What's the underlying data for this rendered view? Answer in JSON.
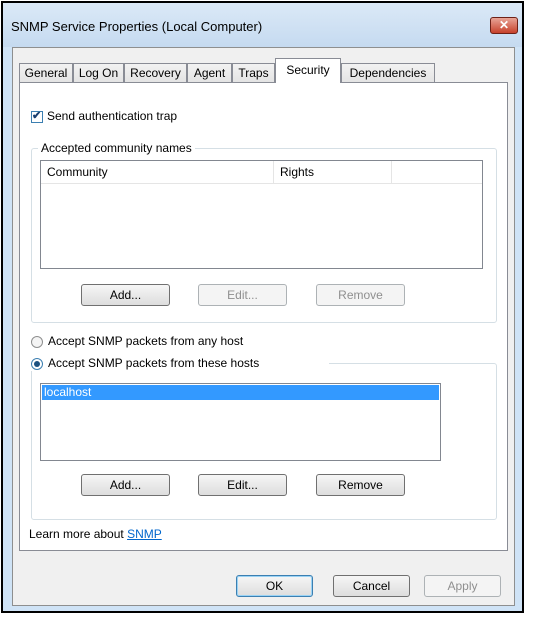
{
  "window": {
    "title": "SNMP Service Properties (Local Computer)",
    "close_glyph": "✕"
  },
  "tabs": [
    {
      "label": "General"
    },
    {
      "label": "Log On"
    },
    {
      "label": "Recovery"
    },
    {
      "label": "Agent"
    },
    {
      "label": "Traps"
    },
    {
      "label": "Security"
    },
    {
      "label": "Dependencies"
    }
  ],
  "active_tab": "Security",
  "send_auth_trap": {
    "label": "Send authentication trap",
    "checked": true,
    "check_glyph": "✔"
  },
  "community": {
    "group_label": "Accepted community names",
    "columns": [
      "Community",
      "Rights"
    ],
    "rows": [],
    "buttons": {
      "add": "Add...",
      "edit": "Edit...",
      "remove": "Remove"
    }
  },
  "hosts": {
    "radio_any": "Accept SNMP packets from any host",
    "radio_these": "Accept SNMP packets from these hosts",
    "selected_option": "these",
    "items": [
      "localhost"
    ],
    "buttons": {
      "add": "Add...",
      "edit": "Edit...",
      "remove": "Remove"
    }
  },
  "learn_more": {
    "text": "Learn more about ",
    "link": "SNMP"
  },
  "footer": {
    "ok": "OK",
    "cancel": "Cancel",
    "apply": "Apply"
  },
  "colors": {
    "selection": "#3399ff",
    "link": "#0066cc",
    "close": "#c7412b"
  }
}
